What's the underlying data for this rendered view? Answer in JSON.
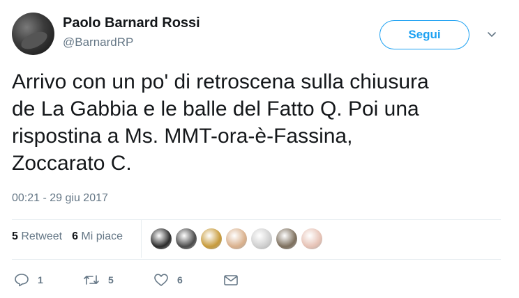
{
  "user": {
    "name": "Paolo Barnard Rossi",
    "handle": "@BarnardRP"
  },
  "follow_label": "Segui",
  "tweet": {
    "lines": [
      "Arrivo con un po' di retroscena sulla chiusura",
      "de La Gabbia e le balle del Fatto Q. Poi una",
      "rispostina a Ms. MMT-ora-è-Fassina,",
      "Zoccarato C."
    ],
    "timestamp": "00:21 - 29 giu 2017"
  },
  "stats": {
    "retweet_count": "5",
    "retweet_label": "Retweet",
    "like_count": "6",
    "like_label": "Mi piace"
  },
  "likers": [
    {
      "color": "#2b2b2b"
    },
    {
      "color": "#4a4a4a"
    },
    {
      "color": "#c79a3a"
    },
    {
      "color": "#d9b08c"
    },
    {
      "color": "#cfcfcf"
    },
    {
      "color": "#7d6f5d"
    },
    {
      "color": "#e6c2b5"
    }
  ],
  "actions": {
    "reply_count": "1",
    "retweet_count": "5",
    "like_count": "6"
  },
  "colors": {
    "accent": "#1da1f2",
    "secondary_text": "#657786",
    "divider": "#e6ecf0"
  }
}
